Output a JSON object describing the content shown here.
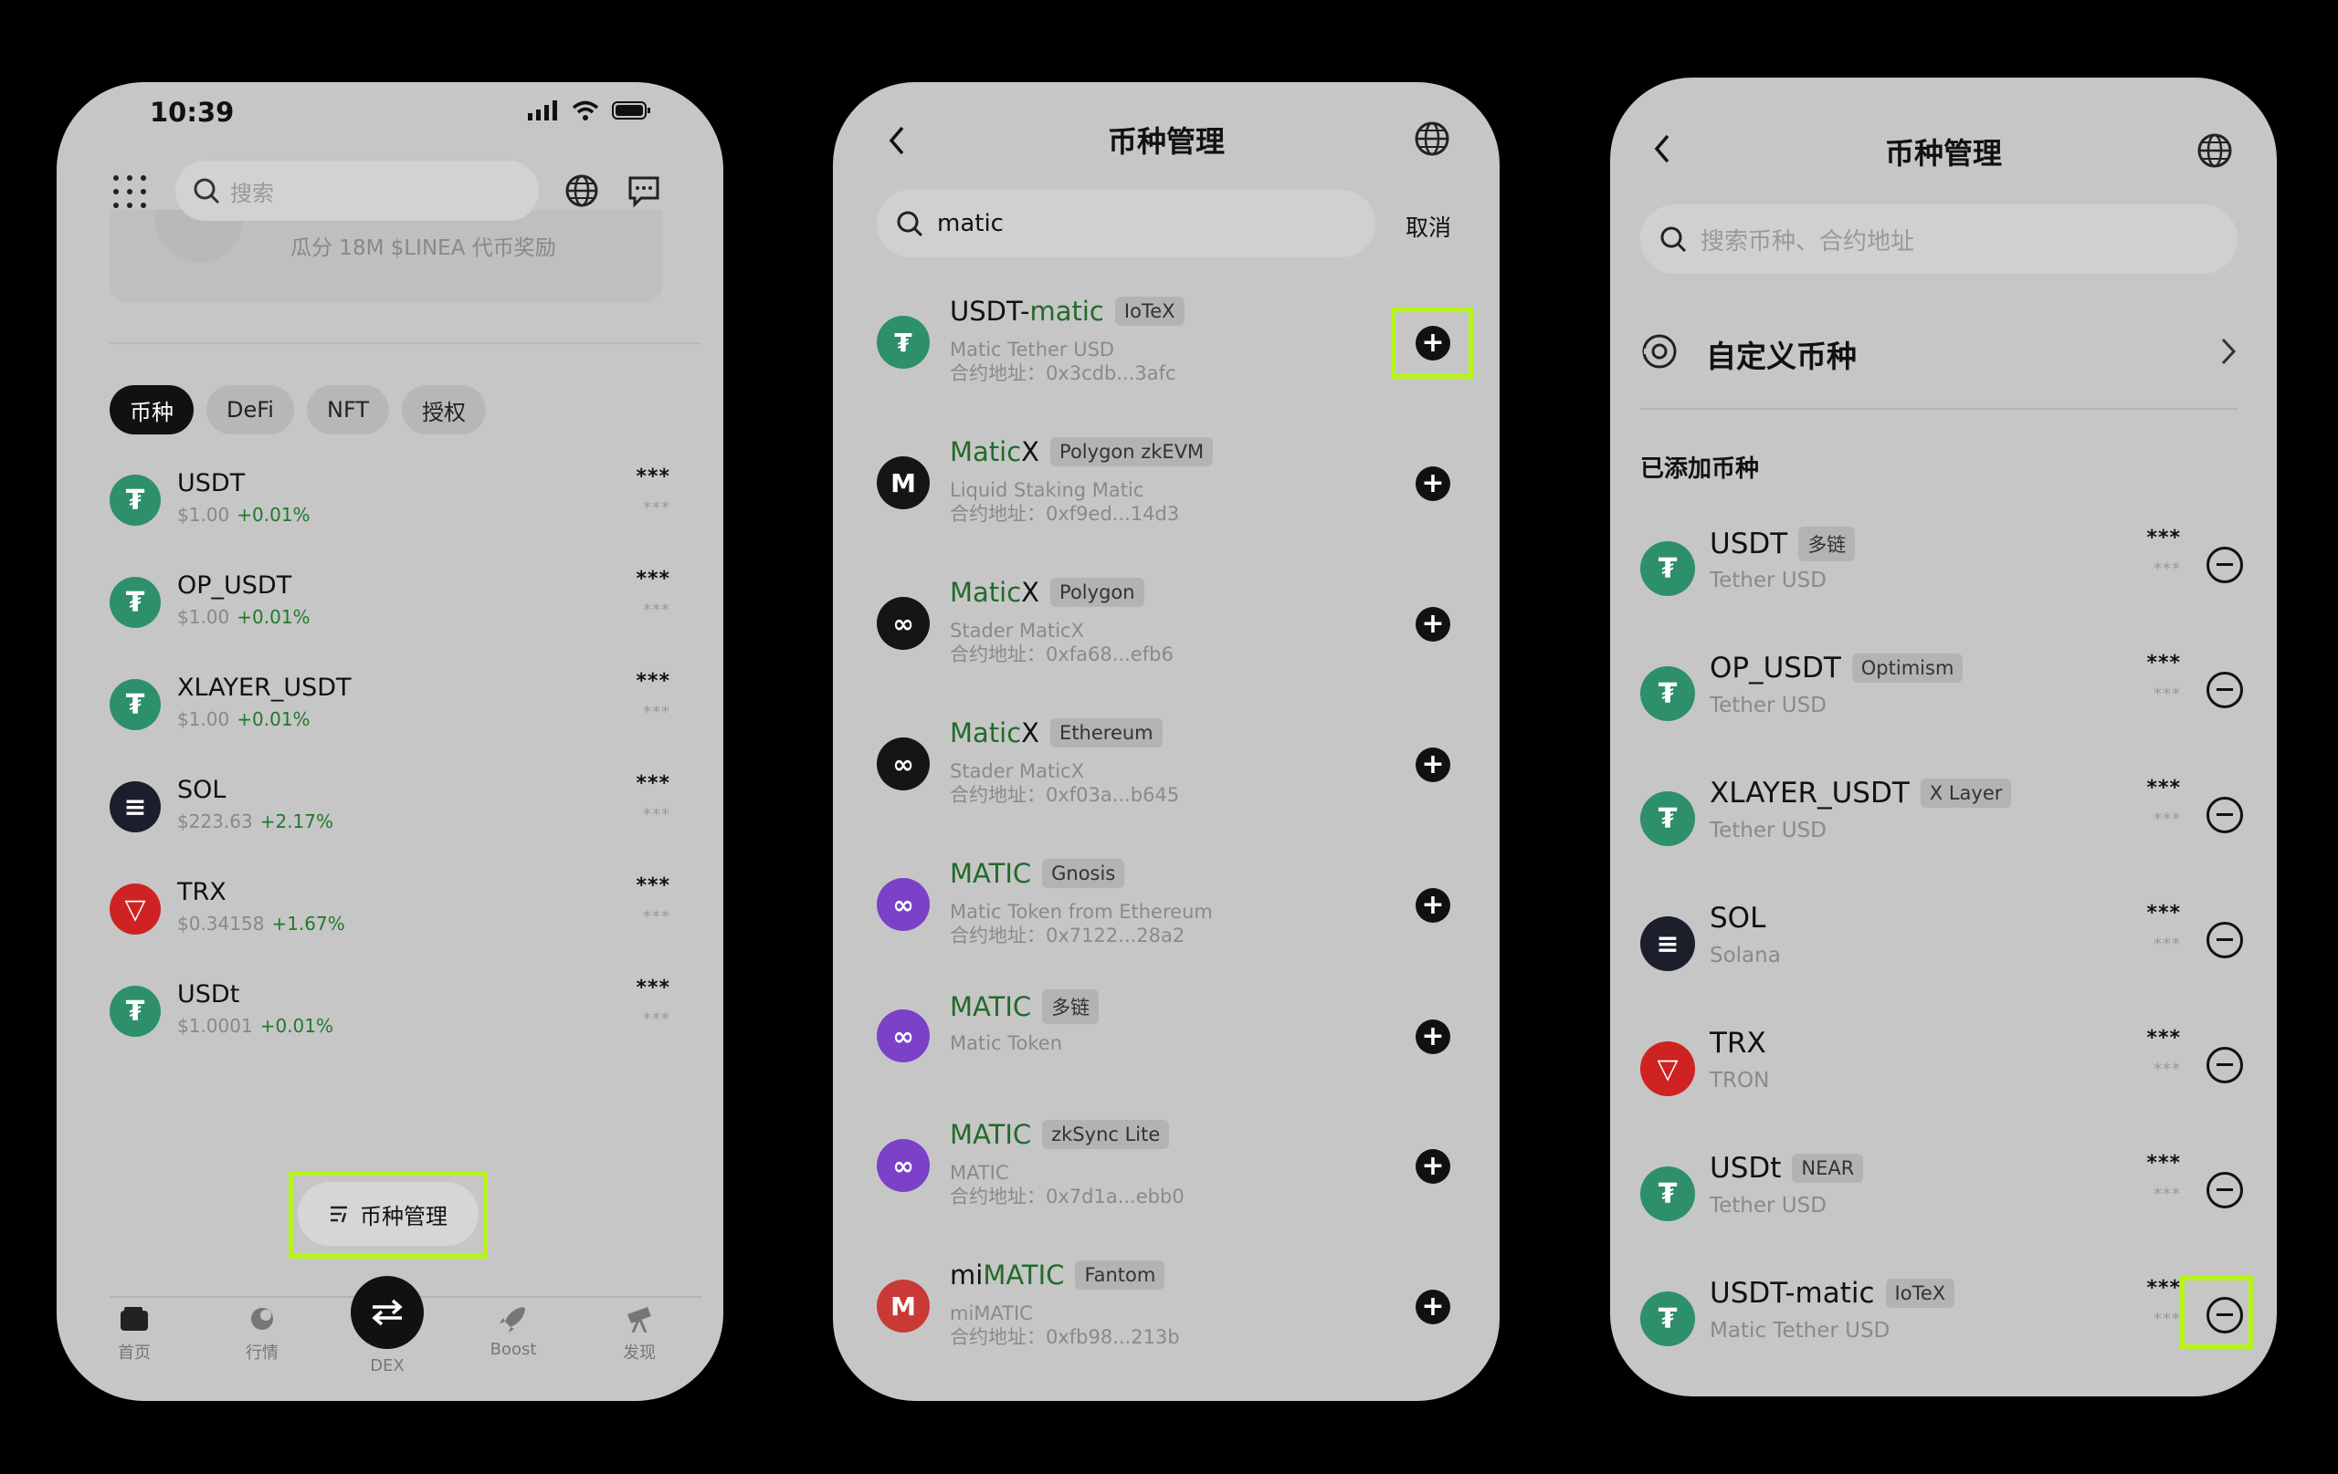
{
  "phone1": {
    "time": "10:39",
    "search_placeholder": "搜索",
    "banner_text": "瓜分 18M $LINEA 代币奖励",
    "tabs": [
      "币种",
      "DeFi",
      "NFT",
      "授权"
    ],
    "assets": [
      {
        "name": "USDT",
        "price": "$1.00",
        "change": "+0.01%",
        "value": "***",
        "sub_value": "***"
      },
      {
        "name": "OP_USDT",
        "price": "$1.00",
        "change": "+0.01%",
        "value": "***",
        "sub_value": "***"
      },
      {
        "name": "XLAYER_USDT",
        "price": "$1.00",
        "change": "+0.01%",
        "value": "***",
        "sub_value": "***"
      },
      {
        "name": "SOL",
        "price": "$223.63",
        "change": "+2.17%",
        "value": "***",
        "sub_value": "***"
      },
      {
        "name": "TRX",
        "price": "$0.34158",
        "change": "+1.67%",
        "value": "***",
        "sub_value": "***"
      },
      {
        "name": "USDt",
        "price": "$1.0001",
        "change": "+0.01%",
        "value": "***",
        "sub_value": "***"
      }
    ],
    "manage_label": "币种管理",
    "nav": [
      "首页",
      "行情",
      "DEX",
      "Boost",
      "发现"
    ]
  },
  "phone2": {
    "title": "币种管理",
    "search_value": "matic",
    "cancel_label": "取消",
    "results": [
      {
        "name_pre": "USDT-",
        "name_hl": "matic",
        "name_post": "",
        "chain": "IoTeX",
        "desc": "Matic Tether USD",
        "address": "合约地址：0x3cdb...3afc"
      },
      {
        "name_pre": "",
        "name_hl": "Matic",
        "name_post": "X",
        "chain": "Polygon zkEVM",
        "desc": "Liquid Staking Matic",
        "address": "合约地址：0xf9ed...14d3"
      },
      {
        "name_pre": "",
        "name_hl": "Matic",
        "name_post": "X",
        "chain": "Polygon",
        "desc": "Stader MaticX",
        "address": "合约地址：0xfa68...efb6"
      },
      {
        "name_pre": "",
        "name_hl": "Matic",
        "name_post": "X",
        "chain": "Ethereum",
        "desc": "Stader MaticX",
        "address": "合约地址：0xf03a...b645"
      },
      {
        "name_pre": "",
        "name_hl": "MATIC",
        "name_post": "",
        "chain": "Gnosis",
        "desc": "Matic Token from Ethereum",
        "address": "合约地址：0x7122...28a2"
      },
      {
        "name_pre": "",
        "name_hl": "MATIC",
        "name_post": "",
        "chain": "多链",
        "desc": "Matic Token",
        "address": ""
      },
      {
        "name_pre": "",
        "name_hl": "MATIC",
        "name_post": "",
        "chain": "zkSync Lite",
        "desc": "MATIC",
        "address": "合约地址：0x7d1a...ebb0"
      },
      {
        "name_pre": "mi",
        "name_hl": "MATIC",
        "name_post": "",
        "chain": "Fantom",
        "desc": "miMATIC",
        "address": "合约地址：0xfb98...213b"
      }
    ]
  },
  "phone3": {
    "title": "币种管理",
    "search_placeholder": "搜索币种、合约地址",
    "custom_label": "自定义币种",
    "added_label": "已添加币种",
    "added": [
      {
        "name": "USDT",
        "chain": "多链",
        "desc": "Tether USD",
        "value": "***",
        "sub_value": "***"
      },
      {
        "name": "OP_USDT",
        "chain": "Optimism",
        "desc": "Tether USD",
        "value": "***",
        "sub_value": "***"
      },
      {
        "name": "XLAYER_USDT",
        "chain": "X Layer",
        "desc": "Tether USD",
        "value": "***",
        "sub_value": "***"
      },
      {
        "name": "SOL",
        "chain": "",
        "desc": "Solana",
        "value": "***",
        "sub_value": "***"
      },
      {
        "name": "TRX",
        "chain": "",
        "desc": "TRON",
        "value": "***",
        "sub_value": "***"
      },
      {
        "name": "USDt",
        "chain": "NEAR",
        "desc": "Tether USD",
        "value": "***",
        "sub_value": "***"
      },
      {
        "name": "USDT-matic",
        "chain": "IoTeX",
        "desc": "Matic Tether USD",
        "value": "***",
        "sub_value": "***"
      }
    ]
  },
  "colors": {
    "highlight": "#b6f518",
    "positive": "#1e7a2a",
    "match": "#226a2a"
  }
}
